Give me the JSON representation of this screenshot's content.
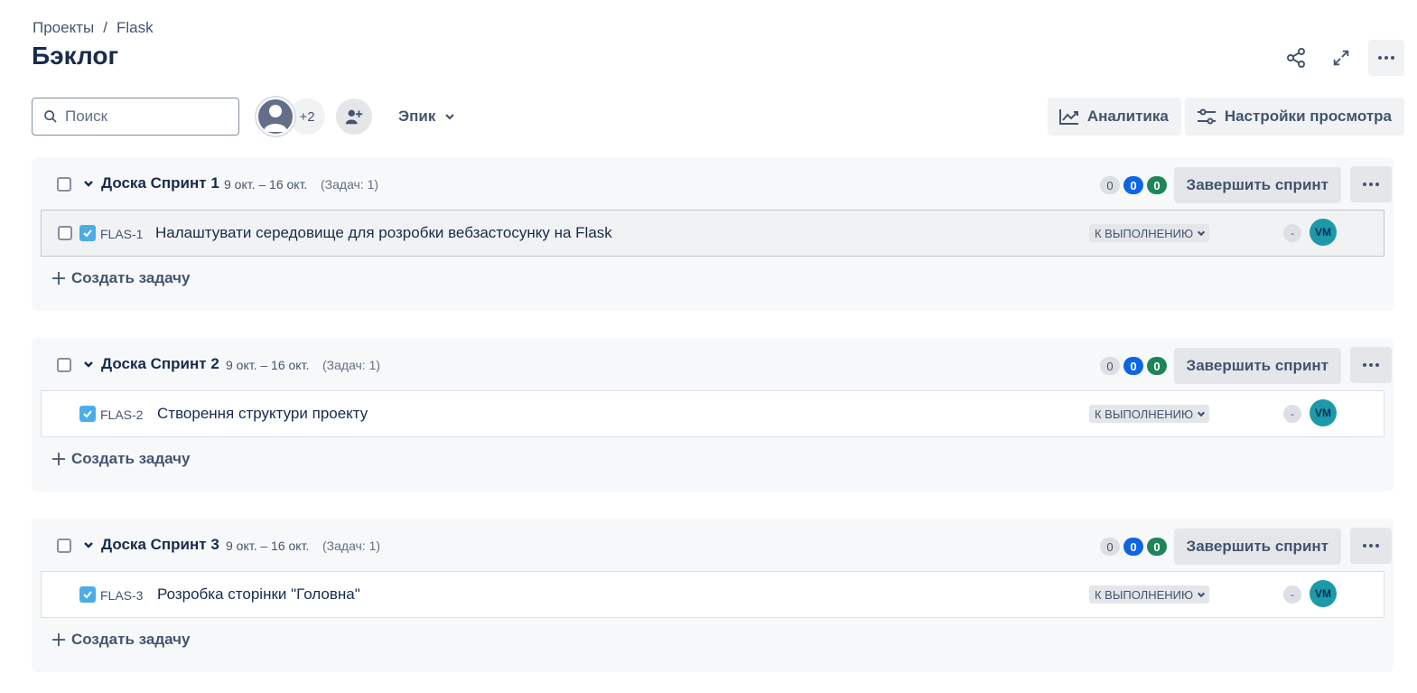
{
  "breadcrumb": {
    "items": [
      "Проекты",
      "Flask"
    ],
    "separator": "/"
  },
  "page_title": "Бэклог",
  "header_actions": {
    "share_icon": "share-icon",
    "expand_icon": "expand-icon",
    "more_icon": "more-icon"
  },
  "toolbar": {
    "search_placeholder": "Поиск",
    "search_value": "",
    "avatars_more": "+2",
    "epic_label": "Эпик",
    "analytics_label": "Аналитика",
    "view_settings_label": "Настройки просмотра"
  },
  "sprints": [
    {
      "name": "Доска Спринт 1",
      "dates": "9 окт. – 16 окт.",
      "count": "(Задач: 1)",
      "badges": {
        "todo": "0",
        "in_progress": "0",
        "done": "0"
      },
      "complete_label": "Завершить спринт",
      "create_label": "Создать задачу",
      "issue": {
        "key": "FLAS-1",
        "summary": "Налаштувати середовище для розробки вебзастосунку на Flask",
        "status": "К ВЫПОЛНЕНИЮ",
        "estimate": "-",
        "assignee": "VM",
        "selected": true
      }
    },
    {
      "name": "Доска Спринт 2",
      "dates": "9 окт. – 16 окт.",
      "count": "(Задач: 1)",
      "badges": {
        "todo": "0",
        "in_progress": "0",
        "done": "0"
      },
      "complete_label": "Завершить спринт",
      "create_label": "Создать задачу",
      "issue": {
        "key": "FLAS-2",
        "summary": "Створення структури проекту",
        "status": "К ВЫПОЛНЕНИЮ",
        "estimate": "-",
        "assignee": "VM",
        "selected": false
      }
    },
    {
      "name": "Доска Спринт 3",
      "dates": "9 окт. – 16 окт.",
      "count": "(Задач: 1)",
      "badges": {
        "todo": "0",
        "in_progress": "0",
        "done": "0"
      },
      "complete_label": "Завершить спринт",
      "create_label": "Создать задачу",
      "issue": {
        "key": "FLAS-3",
        "summary": "Розробка сторінки \"Головна\"",
        "status": "К ВЫПОЛНЕНИЮ",
        "estimate": "-",
        "assignee": "VM",
        "selected": false
      }
    }
  ],
  "colors": {
    "text": "#172b4d",
    "subtle": "#44546f",
    "blue": "#0c66e4",
    "green": "#1f845a",
    "story_icon": "#4bade8",
    "assignee_bg": "#1d9aaa"
  }
}
